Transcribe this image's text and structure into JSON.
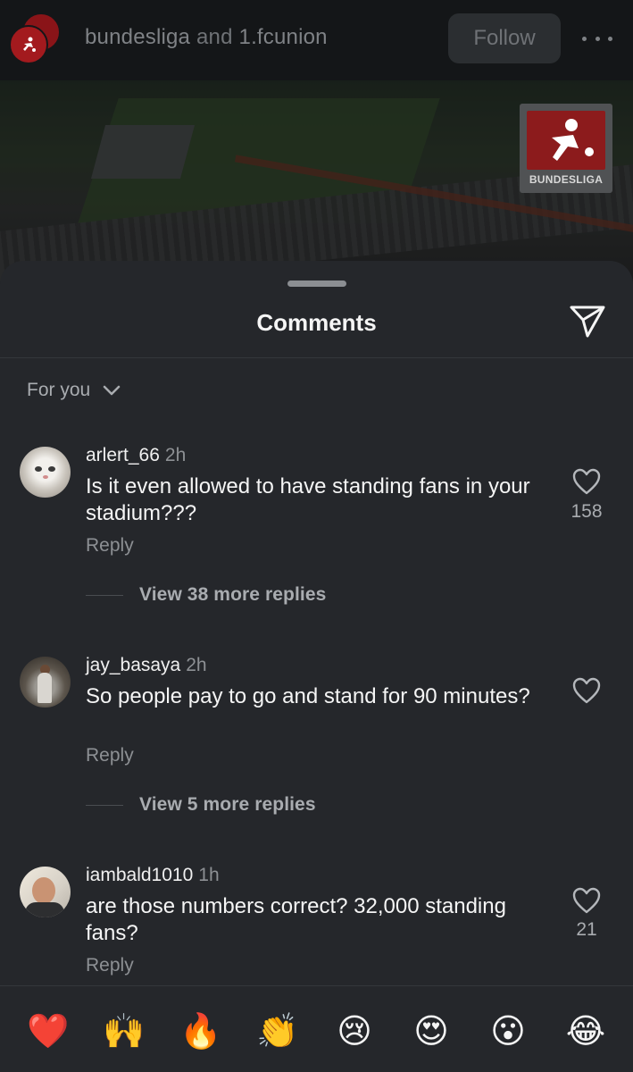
{
  "post": {
    "title_user1": "bundesliga",
    "title_and": "and",
    "title_user2": "1.fcunion",
    "follow_label": "Follow",
    "more_icon": "more-horizontal-icon",
    "image_logo_text": "BUNDESLIGA"
  },
  "sheet": {
    "title": "Comments",
    "share_icon": "send-icon",
    "sort_label": "For you"
  },
  "comments": [
    {
      "username": "arlert_66",
      "time": "2h",
      "text": "Is it even allowed to have standing fans in your stadium???",
      "reply_label": "Reply",
      "likes": "158",
      "more_replies": "View 38 more replies"
    },
    {
      "username": "jay_basaya",
      "time": "2h",
      "text": "So people pay to go and stand for 90 minutes?",
      "reply_label": "Reply",
      "likes": "",
      "more_replies": "View 5 more replies"
    },
    {
      "username": "iambald1010",
      "time": "1h",
      "text": "are those numbers correct? 32,000 standing fans?",
      "reply_label": "Reply",
      "likes": "21"
    }
  ],
  "reactions": [
    "❤️",
    "🙌",
    "🔥",
    "👏",
    "😢",
    "😍",
    "😮",
    "😂"
  ],
  "colors": {
    "sheet_bg": "#25272b",
    "header_bg": "#141618",
    "brand_red": "#a31a1e"
  }
}
